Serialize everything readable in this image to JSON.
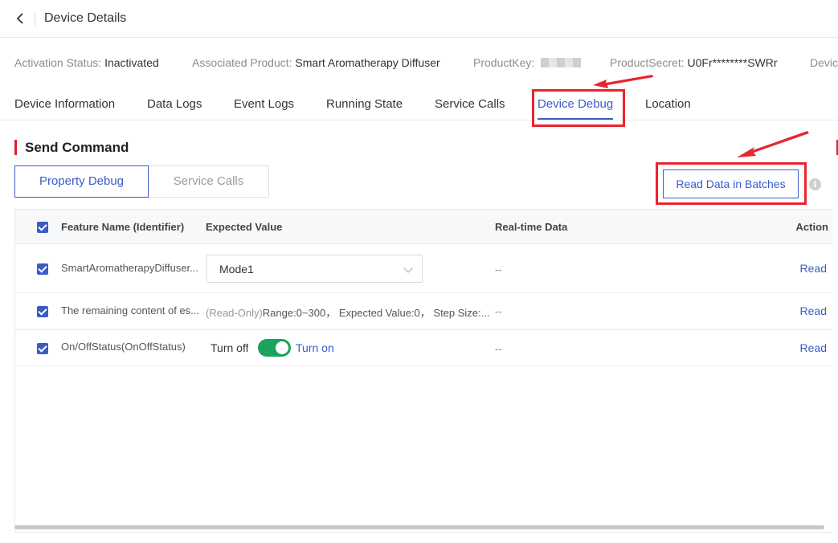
{
  "header": {
    "title": "Device Details"
  },
  "meta": [
    {
      "label": "Activation Status:",
      "value": "Inactivated"
    },
    {
      "label": "Associated Product:",
      "value": "Smart Aromatherapy Diffuser"
    },
    {
      "label": "ProductKey:",
      "value": ""
    },
    {
      "label": "ProductSecret:",
      "value": "U0Fr********SWRr"
    },
    {
      "label": "Devic",
      "value": ""
    }
  ],
  "tabs": [
    "Device Information",
    "Data Logs",
    "Event Logs",
    "Running State",
    "Service Calls",
    "Device Debug",
    "Location"
  ],
  "active_tab": "Device Debug",
  "section": {
    "title": "Send Command"
  },
  "subtabs": [
    "Property Debug",
    "Service Calls"
  ],
  "batch_button": "Read Data in Batches",
  "info_icon": "i",
  "table": {
    "headers": [
      "Feature Name (Identifier)",
      "Expected Value",
      "Real-time Data",
      "Action"
    ],
    "rows": [
      {
        "name": "SmartAromatherapyDiffuser...",
        "select_value": "Mode1",
        "realtime": "--",
        "action": "Read"
      },
      {
        "name": "The remaining content of es...",
        "readonly_tag": "(Read-Only)",
        "expected_text": "Range:0~300， Expected Value:0， Step Size:...",
        "realtime": "--",
        "action": "Read"
      },
      {
        "name": "On/OffStatus(OnOffStatus)",
        "toggle_off": "Turn off",
        "toggle_on": "Turn on",
        "toggle_state": "on",
        "realtime": "--",
        "action": "Read"
      }
    ]
  },
  "colors": {
    "accent": "#3a5cc9",
    "annotation": "#e8252f",
    "toggle_on": "#1aa35c"
  }
}
